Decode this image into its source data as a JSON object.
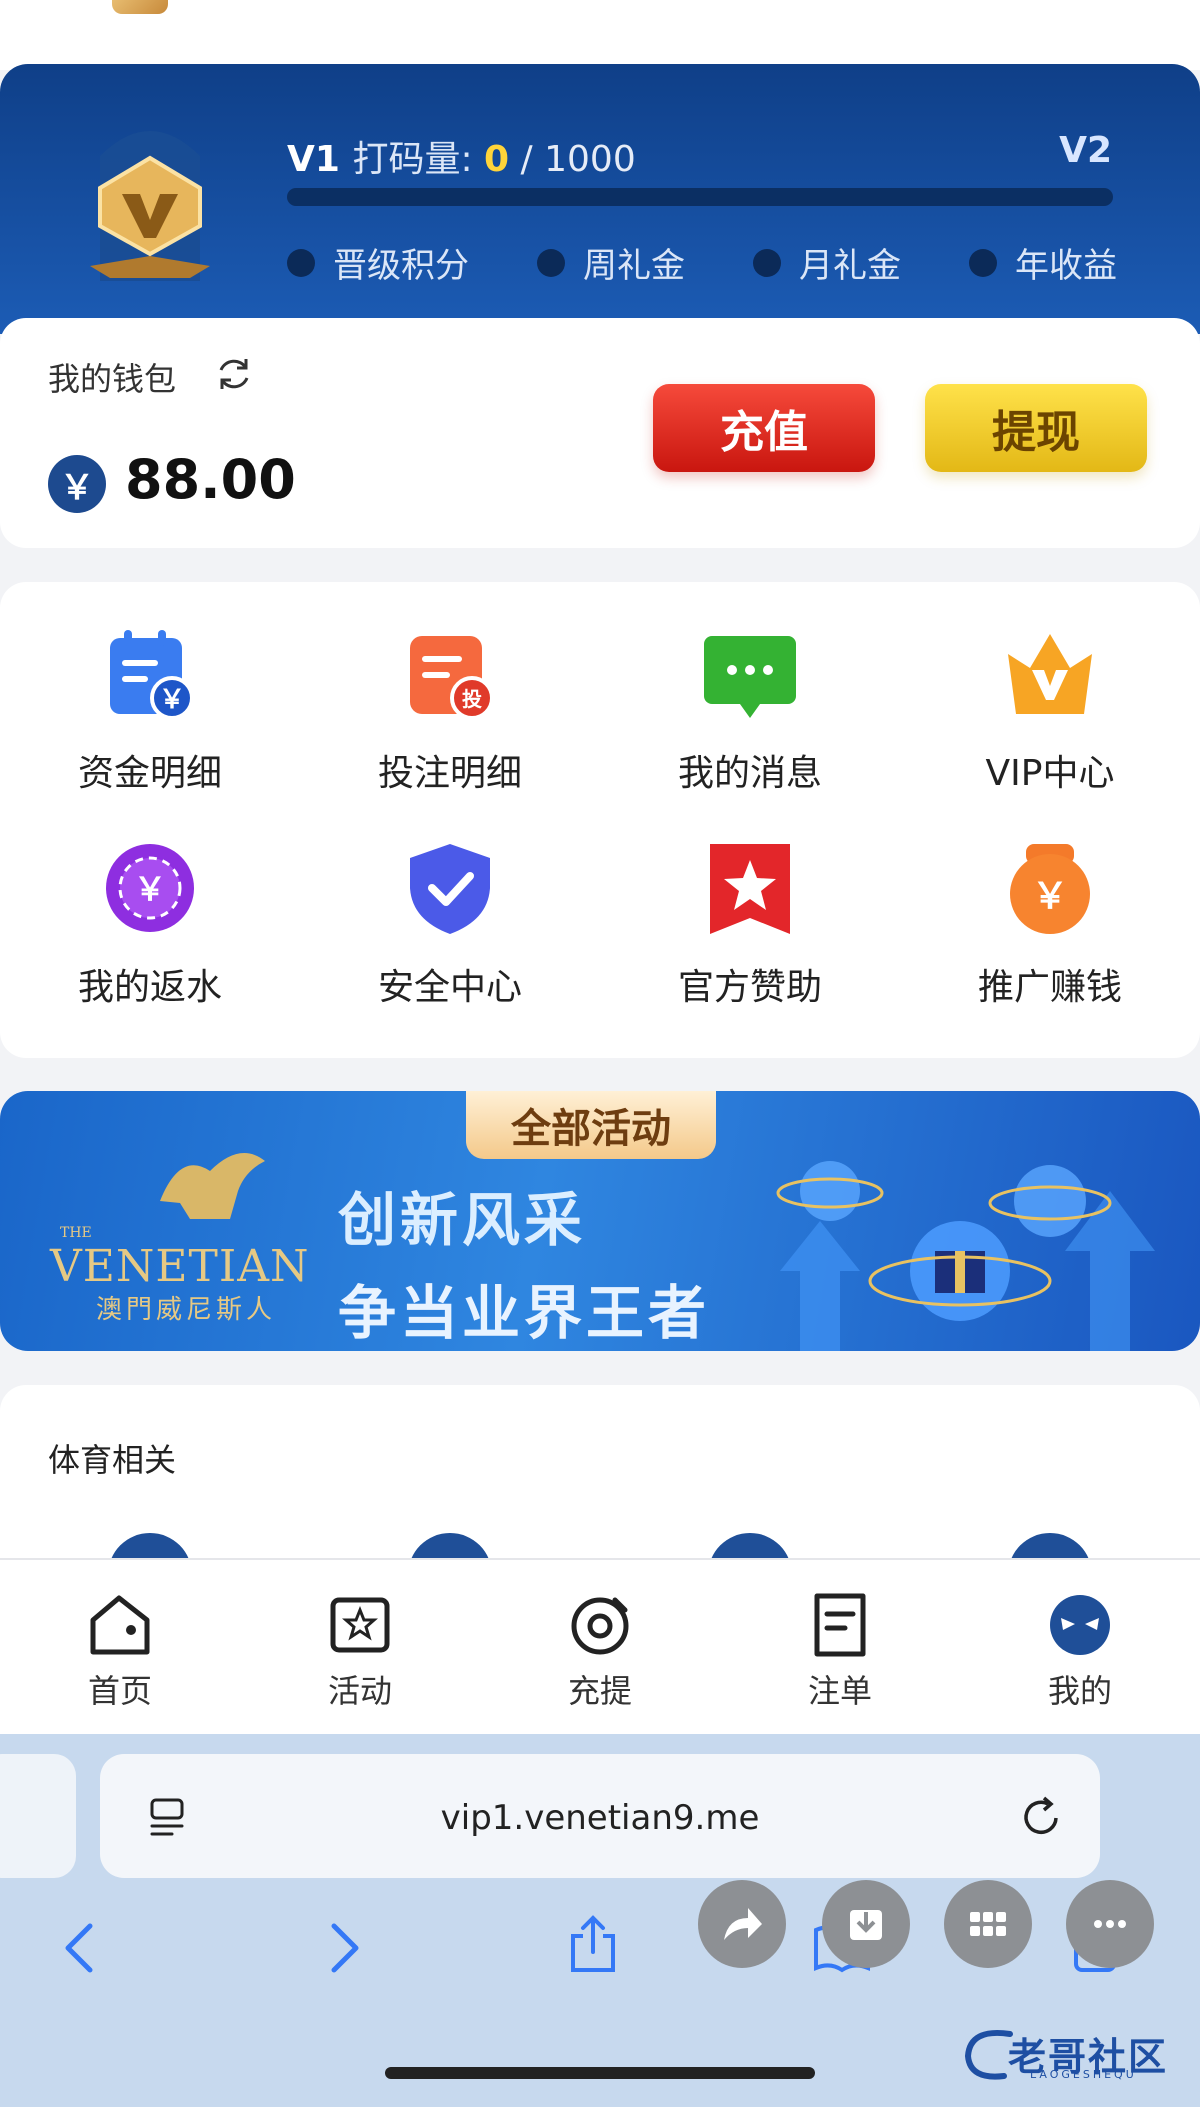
{
  "vip": {
    "level": "V1",
    "progress_label": "打码量: ",
    "progress_current": "0",
    "progress_total": " / 1000",
    "progress_fraction": 0,
    "next_level": "V2",
    "perks": [
      "晋级积分",
      "周礼金",
      "月礼金",
      "年收益"
    ]
  },
  "wallet": {
    "label": "我的钱包",
    "currency_symbol": "￥",
    "balance": "88.00",
    "deposit_label": "充值",
    "withdraw_label": "提现"
  },
  "menu": [
    {
      "label": "资金明细",
      "icon": "fund-details-icon"
    },
    {
      "label": "投注明细",
      "icon": "bet-details-icon",
      "badge": "投"
    },
    {
      "label": "我的消息",
      "icon": "message-icon"
    },
    {
      "label": "VIP中心",
      "icon": "vip-crown-icon"
    },
    {
      "label": "我的返水",
      "icon": "rebate-chip-icon"
    },
    {
      "label": "安全中心",
      "icon": "security-shield-icon"
    },
    {
      "label": "官方赞助",
      "icon": "sponsor-star-icon"
    },
    {
      "label": "推广赚钱",
      "icon": "promote-money-icon"
    }
  ],
  "banner": {
    "tag": "全部活动",
    "brand_the": "THE",
    "brand_name": "VENETIAN",
    "brand_sub": "澳門威尼斯人",
    "slogan_line1": "创新风采",
    "slogan_line2": "争当业界王者"
  },
  "sports": {
    "title": "体育相关"
  },
  "tabs": [
    {
      "label": "首页",
      "icon": "home-icon"
    },
    {
      "label": "活动",
      "icon": "activity-icon"
    },
    {
      "label": "充提",
      "icon": "deposit-withdraw-icon"
    },
    {
      "label": "注单",
      "icon": "bet-slip-icon"
    },
    {
      "label": "我的",
      "icon": "profile-icon"
    }
  ],
  "browser": {
    "url": "vip1.venetian9.me"
  },
  "watermark": {
    "text": "老哥社区",
    "sub": "LAOGESHEQU"
  },
  "colors": {
    "vip_bg": "#0f3f88",
    "deposit": "#e0261c",
    "withdraw": "#f0c928",
    "accent_yellow": "#ffd43a"
  }
}
